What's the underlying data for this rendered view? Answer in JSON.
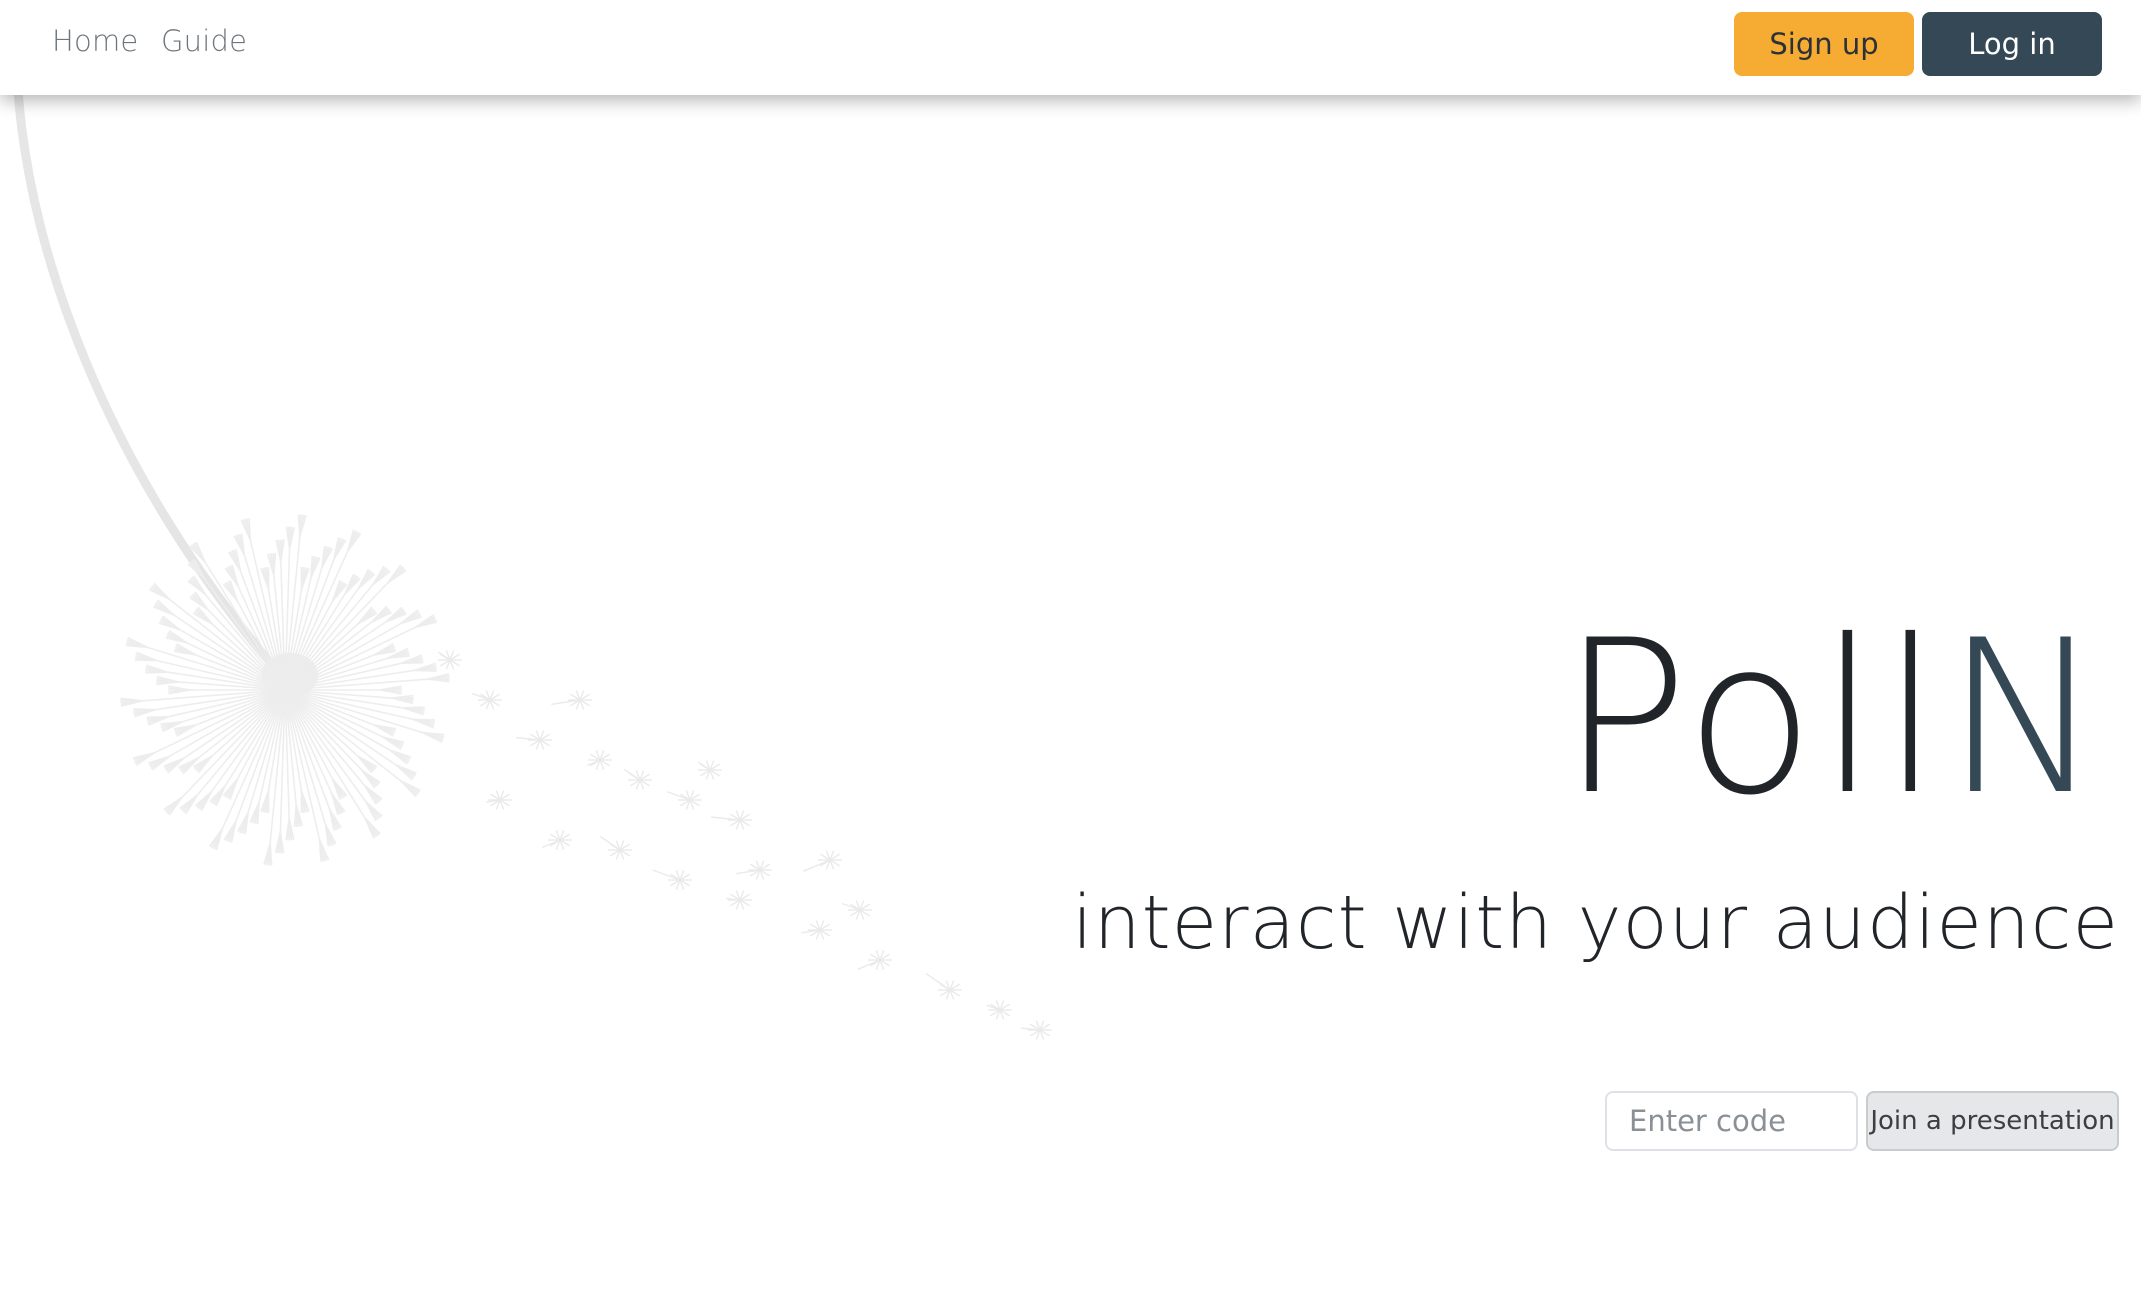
{
  "nav": {
    "links": [
      {
        "label": "Home"
      },
      {
        "label": "Guide"
      }
    ],
    "signup_label": "Sign up",
    "login_label": "Log in"
  },
  "hero": {
    "brand_part1": "Poll",
    "brand_part2": "N",
    "tagline": "interact with your audience"
  },
  "join": {
    "code_placeholder": "Enter code",
    "button_label": "Join a presentation"
  },
  "colors": {
    "signup": "#f6ab33",
    "login": "#344955",
    "brand_accent": "#344955",
    "text": "#212529"
  },
  "icons": {
    "background": "dandelion-illustration"
  }
}
